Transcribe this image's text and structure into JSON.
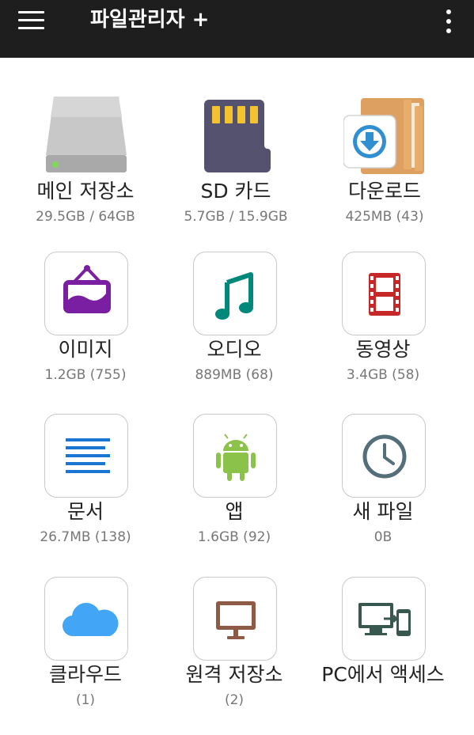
{
  "app": {
    "title": "파일관리자 +"
  },
  "items": [
    {
      "label": "메인 저장소",
      "info": "29.5GB / 64GB",
      "icon": "hard-drive-icon"
    },
    {
      "label": "SD 카드",
      "info": "5.7GB / 15.9GB",
      "icon": "sd-card-icon"
    },
    {
      "label": "다운로드",
      "info": "425MB (43)",
      "icon": "download-folder-icon"
    },
    {
      "label": "이미지",
      "info": "1.2GB (755)",
      "icon": "image-frame-icon"
    },
    {
      "label": "오디오",
      "info": "889MB (68)",
      "icon": "music-note-icon"
    },
    {
      "label": "동영상",
      "info": "3.4GB (58)",
      "icon": "film-icon"
    },
    {
      "label": "문서",
      "info": "26.7MB (138)",
      "icon": "document-lines-icon"
    },
    {
      "label": "앱",
      "info": "1.6GB (92)",
      "icon": "android-icon"
    },
    {
      "label": "새 파일",
      "info": "0B",
      "icon": "clock-icon"
    },
    {
      "label": "클라우드",
      "info": "(1)",
      "icon": "cloud-icon"
    },
    {
      "label": "원격 저장소",
      "info": "(2)",
      "icon": "monitor-icon"
    },
    {
      "label": "PC에서 액세스",
      "info": "",
      "icon": "pc-transfer-icon"
    }
  ],
  "colors": {
    "appbar": "#1e1e1e",
    "image": "#7b1fa2",
    "audio": "#00897b",
    "video": "#c62828",
    "document": "#1976d2",
    "app": "#8bc34a",
    "recent": "#546e7a",
    "cloud": "#42a5f5",
    "remote": "#8d5a45",
    "pc": "#37574f"
  }
}
